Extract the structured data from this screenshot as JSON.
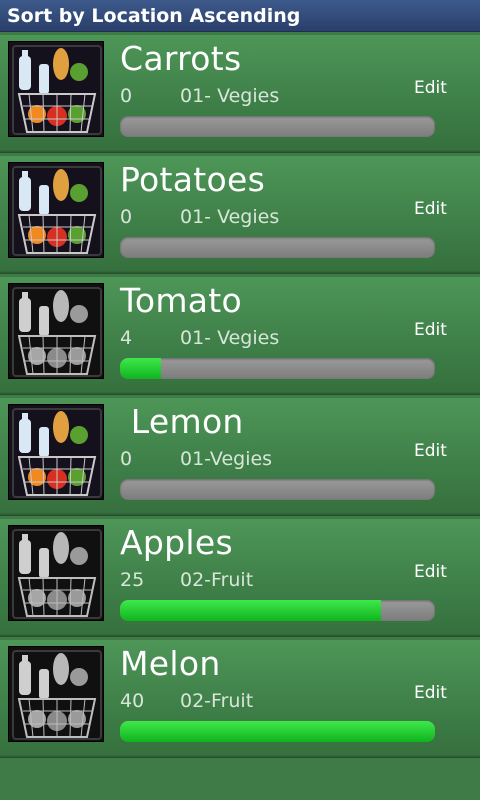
{
  "title": "Sort by Location Ascending",
  "colors": {
    "title_bar": "#2f4a7c",
    "row_green": "#448a4e",
    "progress_fill": "#1ec72c",
    "progress_track": "#8c8c8c"
  },
  "items": [
    {
      "name": "Carrots",
      "qty": "0",
      "location": "01- Vegies",
      "edit": "Edit",
      "progress": 0,
      "icon": "buy-basket-color-icon"
    },
    {
      "name": "Potatoes",
      "qty": "0",
      "location": "01- Vegies",
      "edit": "Edit",
      "progress": 0,
      "icon": "buy-basket-color-icon"
    },
    {
      "name": "Tomato",
      "qty": "4",
      "location": "01- Vegies",
      "edit": "Edit",
      "progress": 0.13,
      "icon": "buy-basket-gray-icon"
    },
    {
      "name": " Lemon",
      "qty": "0",
      "location": "01-Vegies",
      "edit": "Edit",
      "progress": 0,
      "icon": "buy-basket-color-icon"
    },
    {
      "name": "Apples",
      "qty": "25",
      "location": "02-Fruit",
      "edit": "Edit",
      "progress": 0.83,
      "icon": "buy-basket-gray-icon"
    },
    {
      "name": "Melon",
      "qty": "40",
      "location": "02-Fruit",
      "edit": "Edit",
      "progress": 1.0,
      "icon": "buy-basket-gray-icon"
    }
  ]
}
